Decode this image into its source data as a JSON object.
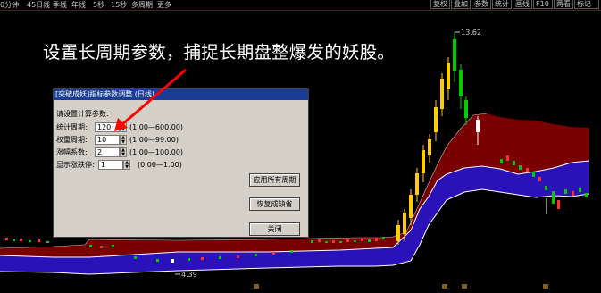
{
  "toolbar": {
    "tabs": [
      "0分钟",
      "45日线",
      "季线",
      "年线",
      "5秒",
      "15秒",
      "多周期",
      "更多"
    ],
    "right_buttons": [
      "复权",
      "叠加",
      "参数",
      "统计",
      "画线",
      "F10",
      "两看",
      "标记"
    ]
  },
  "caption": "设置长周期参数，捕捉长期盘整爆发的妖股。",
  "price_labels": {
    "high": "13.62",
    "low": "4.39"
  },
  "dialog": {
    "title": "[突破成妖]指标参数调整 (日线)",
    "prompt": "请设置计算参数:",
    "params": [
      {
        "label": "统计周期:",
        "value": "120",
        "range": "(1.00—600.00)"
      },
      {
        "label": "权重周期:",
        "value": "10",
        "range": "(1.00—99.00)"
      },
      {
        "label": "涨幅系数:",
        "value": "2",
        "range": "(1.00—100.00)"
      },
      {
        "label": "显示涨跌停:",
        "value": "1",
        "range": "(0.00—1.00)"
      }
    ],
    "buttons": {
      "apply_all": "应用所有周期",
      "restore_default": "恢复成缺省",
      "close": "关闭"
    }
  },
  "colors": {
    "upper_band": "#7a0000",
    "lower_band": "#2a12b8",
    "up_candle": "#ffcc00",
    "down_candle": "#00cc00",
    "arrow": "#ff0000"
  }
}
